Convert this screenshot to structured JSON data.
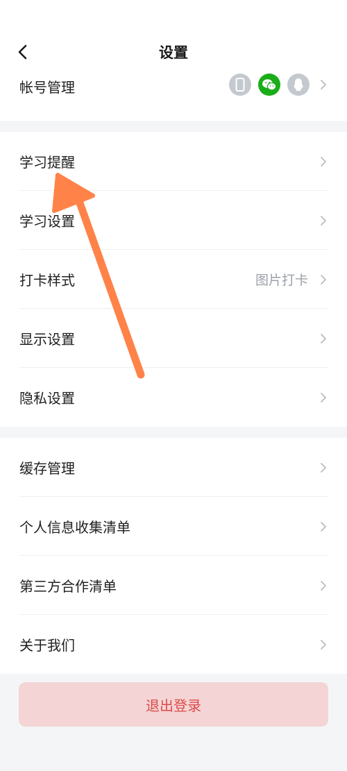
{
  "header": {
    "title": "设置"
  },
  "account": {
    "label": "帐号管理"
  },
  "group1": [
    {
      "label": "学习提醒",
      "value": ""
    },
    {
      "label": "学习设置",
      "value": ""
    },
    {
      "label": "打卡样式",
      "value": "图片打卡"
    },
    {
      "label": "显示设置",
      "value": ""
    },
    {
      "label": "隐私设置",
      "value": ""
    }
  ],
  "group2": [
    {
      "label": "缓存管理"
    },
    {
      "label": "个人信息收集清单"
    },
    {
      "label": "第三方合作清单"
    },
    {
      "label": "关于我们"
    }
  ],
  "logout": {
    "label": "退出登录"
  },
  "colors": {
    "wechat": "#1aad19",
    "logout_bg": "#f4d4d5",
    "logout_text": "#dc4b4b",
    "annotation_arrow": "#ff8248"
  },
  "icons": [
    "back-chevron-icon",
    "phone-icon",
    "wechat-icon",
    "qq-icon",
    "chevron-right-icon"
  ]
}
